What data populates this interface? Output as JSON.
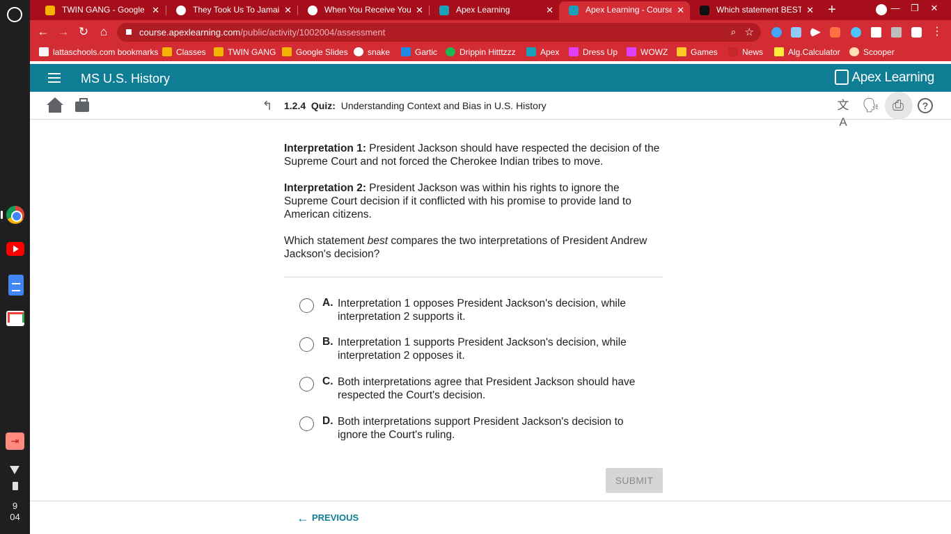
{
  "system": {
    "clock_hour": "9",
    "clock_minute": "04"
  },
  "browser": {
    "tabs": [
      {
        "title": "TWIN GANG - Google Slides",
        "active": false,
        "favicon_color": "#f4b400"
      },
      {
        "title": "They Took Us To Jamaica",
        "active": false,
        "favicon_color": "#ffffff"
      },
      {
        "title": "When You Receive Your Sa",
        "active": false,
        "favicon_color": "#ffffff"
      },
      {
        "title": "Apex Learning",
        "active": false,
        "favicon_color": "#1aa0b8"
      },
      {
        "title": "Apex Learning - Courses",
        "active": true,
        "favicon_color": "#1aa0b8"
      },
      {
        "title": "Which statement BEST de",
        "active": false,
        "favicon_color": "#111111"
      }
    ],
    "url_host": "course.apexlearning.com",
    "url_path": "/public/activity/1002004/assessment",
    "bookmarks": [
      {
        "label": "lattaschools.com bookmarks",
        "icon_color": "#f5f5f5"
      },
      {
        "label": "Classes",
        "icon_color": "#f4b400"
      },
      {
        "label": "TWIN GANG",
        "icon_color": "#f4b400"
      },
      {
        "label": "Google Slides",
        "icon_color": "#f4b400"
      },
      {
        "label": "snake",
        "icon_color": "#ffffff"
      },
      {
        "label": "Gartic",
        "icon_color": "#1e88e5"
      },
      {
        "label": "Drippin Hitttzzz",
        "icon_color": "#1db954"
      },
      {
        "label": "Apex",
        "icon_color": "#1aa0b8"
      },
      {
        "label": "Dress Up",
        "icon_color": "#e040fb"
      },
      {
        "label": "WOWZ",
        "icon_color": "#e040fb"
      },
      {
        "label": "Games",
        "icon_color": "#ffca28"
      },
      {
        "label": "News",
        "icon_color": "#c62828"
      },
      {
        "label": "Alg.Calculator",
        "icon_color": "#ffeb3b"
      },
      {
        "label": "Scooper",
        "icon_color": "#ffe0b2"
      }
    ]
  },
  "app": {
    "course_title": "MS U.S. History",
    "brand": "Apex Learning",
    "quiz_number": "1.2.4",
    "quiz_type": "Quiz:",
    "quiz_title": "Understanding Context and Bias in U.S. History"
  },
  "question": {
    "interp1_label": "Interpretation 1:",
    "interp1_text": "President Jackson should have respected the decision of the Supreme Court and not forced the Cherokee Indian tribes to move.",
    "interp2_label": "Interpretation 2:",
    "interp2_text": "President Jackson was within his rights to ignore the Supreme Court decision if it conflicted with his promise to provide land to American citizens.",
    "prompt_before": "Which statement",
    "prompt_emphasis": "best",
    "prompt_after": "compares the two interpretations of President Andrew Jackson's decision?",
    "options": [
      {
        "letter": "A.",
        "text": "Interpretation 1 opposes President Jackson's decision, while interpretation 2 supports it."
      },
      {
        "letter": "B.",
        "text": "Interpretation 1 supports President Jackson's decision, while interpretation 2 opposes it."
      },
      {
        "letter": "C.",
        "text": "Both interpretations agree that President Jackson should have respected the Court's decision."
      },
      {
        "letter": "D.",
        "text": "Both interpretations support President Jackson's decision to ignore the Court's ruling."
      }
    ]
  },
  "actions": {
    "submit_label": "SUBMIT",
    "previous_label": "PREVIOUS"
  }
}
